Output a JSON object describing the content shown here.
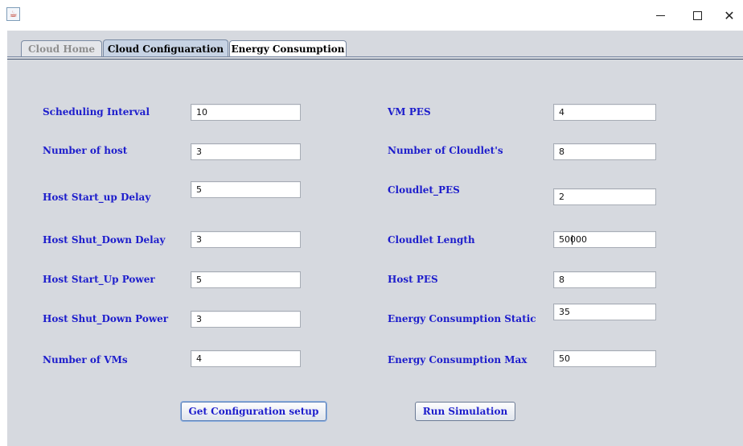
{
  "window": {
    "app_icon": "java-cup-icon",
    "controls": {
      "minimize": "minimize-icon",
      "maximize": "maximize-icon",
      "close": "close-icon"
    }
  },
  "tabs": [
    {
      "label": "Cloud Home",
      "state": "disabled"
    },
    {
      "label": "Cloud Configuaration",
      "state": "selected"
    },
    {
      "label": "Energy Consumption",
      "state": "normal"
    }
  ],
  "form_left": [
    {
      "label": "Scheduling Interval",
      "value": "10"
    },
    {
      "label": "Number of host",
      "value": "3"
    },
    {
      "label": "Host Start_up Delay",
      "value": "5"
    },
    {
      "label": "Host Shut_Down Delay",
      "value": "3"
    },
    {
      "label": "Host Start_Up Power",
      "value": "5"
    },
    {
      "label": "Host Shut_Down Power",
      "value": "3"
    },
    {
      "label": "Number of VMs",
      "value": "4"
    }
  ],
  "form_right": [
    {
      "label": "VM PES",
      "value": "4"
    },
    {
      "label": "Number of Cloudlet's",
      "value": "8"
    },
    {
      "label": "Cloudlet_PES",
      "value": "2"
    },
    {
      "label": "Cloudlet Length",
      "value": "50000"
    },
    {
      "label": "Host PES",
      "value": "8"
    },
    {
      "label": "Energy Consumption Static",
      "value": "35"
    },
    {
      "label": "Energy Consumption Max",
      "value": "50"
    }
  ],
  "buttons": {
    "get_config": "Get Configuration setup",
    "run_simulation": "Run Simulation"
  },
  "colors": {
    "label_text": "#1d1dcc",
    "panel_bg": "#d6d9df",
    "field_bg": "#ffffff"
  }
}
